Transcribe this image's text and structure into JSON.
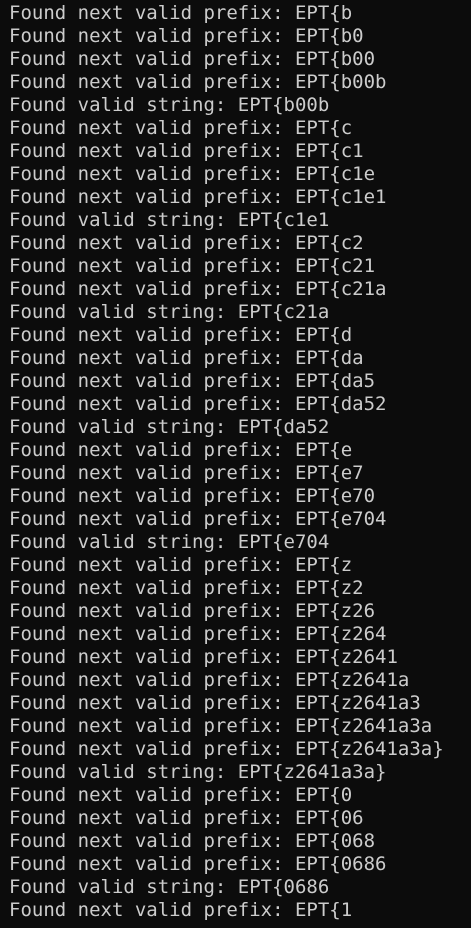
{
  "terminal": {
    "background_color": "#0c0c0c",
    "text_color": "#cccccc",
    "lines": [
      "Found next valid prefix: EPT{b",
      "Found next valid prefix: EPT{b0",
      "Found next valid prefix: EPT{b00",
      "Found next valid prefix: EPT{b00b",
      "Found valid string: EPT{b00b",
      "Found next valid prefix: EPT{c",
      "Found next valid prefix: EPT{c1",
      "Found next valid prefix: EPT{c1e",
      "Found next valid prefix: EPT{c1e1",
      "Found valid string: EPT{c1e1",
      "Found next valid prefix: EPT{c2",
      "Found next valid prefix: EPT{c21",
      "Found next valid prefix: EPT{c21a",
      "Found valid string: EPT{c21a",
      "Found next valid prefix: EPT{d",
      "Found next valid prefix: EPT{da",
      "Found next valid prefix: EPT{da5",
      "Found next valid prefix: EPT{da52",
      "Found valid string: EPT{da52",
      "Found next valid prefix: EPT{e",
      "Found next valid prefix: EPT{e7",
      "Found next valid prefix: EPT{e70",
      "Found next valid prefix: EPT{e704",
      "Found valid string: EPT{e704",
      "Found next valid prefix: EPT{z",
      "Found next valid prefix: EPT{z2",
      "Found next valid prefix: EPT{z26",
      "Found next valid prefix: EPT{z264",
      "Found next valid prefix: EPT{z2641",
      "Found next valid prefix: EPT{z2641a",
      "Found next valid prefix: EPT{z2641a3",
      "Found next valid prefix: EPT{z2641a3a",
      "Found next valid prefix: EPT{z2641a3a}",
      "Found valid string: EPT{z2641a3a}",
      "Found next valid prefix: EPT{0",
      "Found next valid prefix: EPT{06",
      "Found next valid prefix: EPT{068",
      "Found next valid prefix: EPT{0686",
      "Found valid string: EPT{0686",
      "Found next valid prefix: EPT{1"
    ]
  }
}
